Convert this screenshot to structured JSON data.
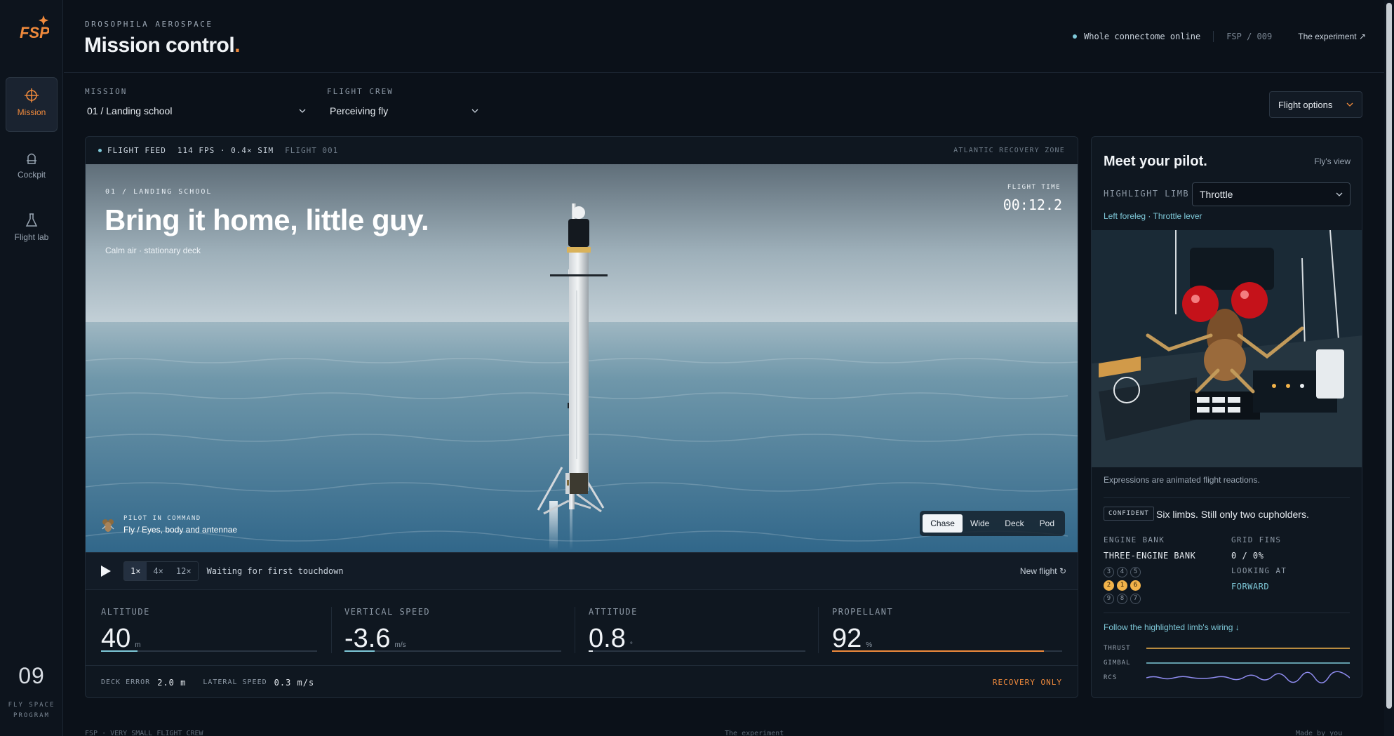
{
  "brand": {
    "logo_text": "FSP",
    "accent": "#f08a3c"
  },
  "sidebar": {
    "items": [
      {
        "label": "Mission",
        "icon": "crosshair-icon",
        "active": true
      },
      {
        "label": "Cockpit",
        "icon": "seat-icon",
        "active": false
      },
      {
        "label": "Flight lab",
        "icon": "flask-icon",
        "active": false
      }
    ],
    "program_number": "09",
    "program_name_line1": "FLY SPACE",
    "program_name_line2": "PROGRAM"
  },
  "header": {
    "org": "DROSOPHILA AEROSPACE",
    "title": "Mission control",
    "title_dot": ".",
    "status": "Whole connectome online",
    "code": "FSP / 009",
    "link": "The experiment ↗"
  },
  "selectors": {
    "mission_label": "MISSION",
    "mission_value": "01 / Landing school",
    "crew_label": "FLIGHT CREW",
    "crew_value": "Perceiving fly",
    "flight_options": "Flight options"
  },
  "feed": {
    "label": "FLIGHT FEED",
    "fps": "114 FPS · 0.4× SIM",
    "flight": "FLIGHT 001",
    "zone": "ATLANTIC RECOVERY ZONE"
  },
  "scene": {
    "eyebrow": "01 / LANDING SCHOOL",
    "headline": "Bring it home, little guy.",
    "sub": "Calm air · stationary deck",
    "flight_time_label": "FLIGHT TIME",
    "flight_time": "00:12.2",
    "pilot_eyebrow": "PILOT IN COMMAND",
    "pilot_name": "Fly / Eyes, body and antennae",
    "cameras": [
      "Chase",
      "Wide",
      "Deck",
      "Pod"
    ],
    "active_camera": "Chase"
  },
  "playback": {
    "speeds": [
      "1×",
      "4×",
      "12×"
    ],
    "active_speed": "1×",
    "status": "Waiting for first touchdown",
    "new_flight": "New flight ↻"
  },
  "telemetry": [
    {
      "label": "ALTITUDE",
      "value": "40",
      "unit": "m",
      "fill": 0.17,
      "color": "#7ec8d8"
    },
    {
      "label": "VERTICAL SPEED",
      "value": "-3.6",
      "unit": "m/s",
      "fill": 0.14,
      "color": "#7ec8d8"
    },
    {
      "label": "ATTITUDE",
      "value": "0.8",
      "unit": "°",
      "fill": 0.02,
      "color": "#e6ebf0"
    },
    {
      "label": "PROPELLANT",
      "value": "92",
      "unit": "%",
      "fill": 0.92,
      "color": "#f08a3c"
    }
  ],
  "footer": {
    "deck_error_label": "DECK ERROR",
    "deck_error": "2.0 m",
    "lateral_label": "LATERAL SPEED",
    "lateral": "0.3 m/s",
    "recovery": "RECOVERY ONLY"
  },
  "pilot": {
    "title": "Meet your pilot.",
    "view": "Fly's view",
    "highlight_label": "HIGHLIGHT LIMB",
    "highlight_value": "Throttle",
    "highlight_desc": "Left foreleg · Throttle lever",
    "expression_note": "Expressions are animated flight reactions.",
    "mood": "CONFIDENT",
    "mood_text": "Six limbs. Still only two cupholders.",
    "engine_bank_label": "ENGINE BANK",
    "engine_bank_value": "THREE-ENGINE BANK",
    "grid_fins_label": "GRID FINS",
    "grid_fins_value": "0 / 0%",
    "looking_label": "LOOKING AT",
    "looking_value": "FORWARD",
    "engines": [
      {
        "n": "3",
        "on": false
      },
      {
        "n": "4",
        "on": false
      },
      {
        "n": "5",
        "on": false
      },
      {
        "n": "2",
        "on": true
      },
      {
        "n": "1",
        "on": true
      },
      {
        "n": "6",
        "on": true
      },
      {
        "n": "9",
        "on": false
      },
      {
        "n": "8",
        "on": false
      },
      {
        "n": "7",
        "on": false
      }
    ],
    "wiring_link": "Follow the highlighted limb's wiring ↓",
    "wires": [
      {
        "label": "THRUST",
        "color": "#f2b34a"
      },
      {
        "label": "GIMBAL",
        "color": "#7ec8d8"
      },
      {
        "label": "RCS",
        "color": "#8f8cf0"
      }
    ]
  },
  "bottom": {
    "left": "FSP · VERY SMALL FLIGHT CREW",
    "center": "The experiment",
    "right": "Made by you"
  }
}
